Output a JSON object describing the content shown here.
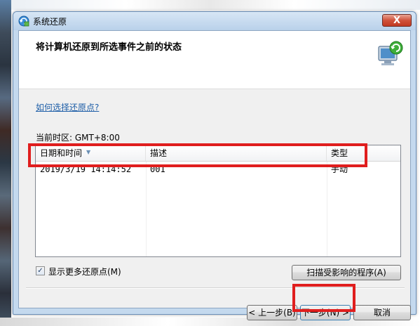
{
  "window": {
    "title": "系统还原",
    "close_label": "X"
  },
  "header": {
    "title": "将计算机还原到所选事件之前的状态"
  },
  "help_link": "如何选择还原点?",
  "timezone_label": "当前时区: GMT+8:00",
  "table": {
    "columns": [
      "日期和时间",
      "描述",
      "类型"
    ],
    "rows": [
      {
        "datetime": "2019/3/19 14:14:52",
        "description": "001",
        "type": "手动"
      }
    ]
  },
  "show_more": {
    "label": "显示更多还原点(M)",
    "checked": true
  },
  "buttons": {
    "scan": "扫描受影响的程序(A)",
    "back": "< 上一步(B)",
    "next": "下一步(N) >",
    "cancel": "取消"
  },
  "colors": {
    "annotation_red": "#e01e1e",
    "link_blue": "#1f5fa8"
  }
}
